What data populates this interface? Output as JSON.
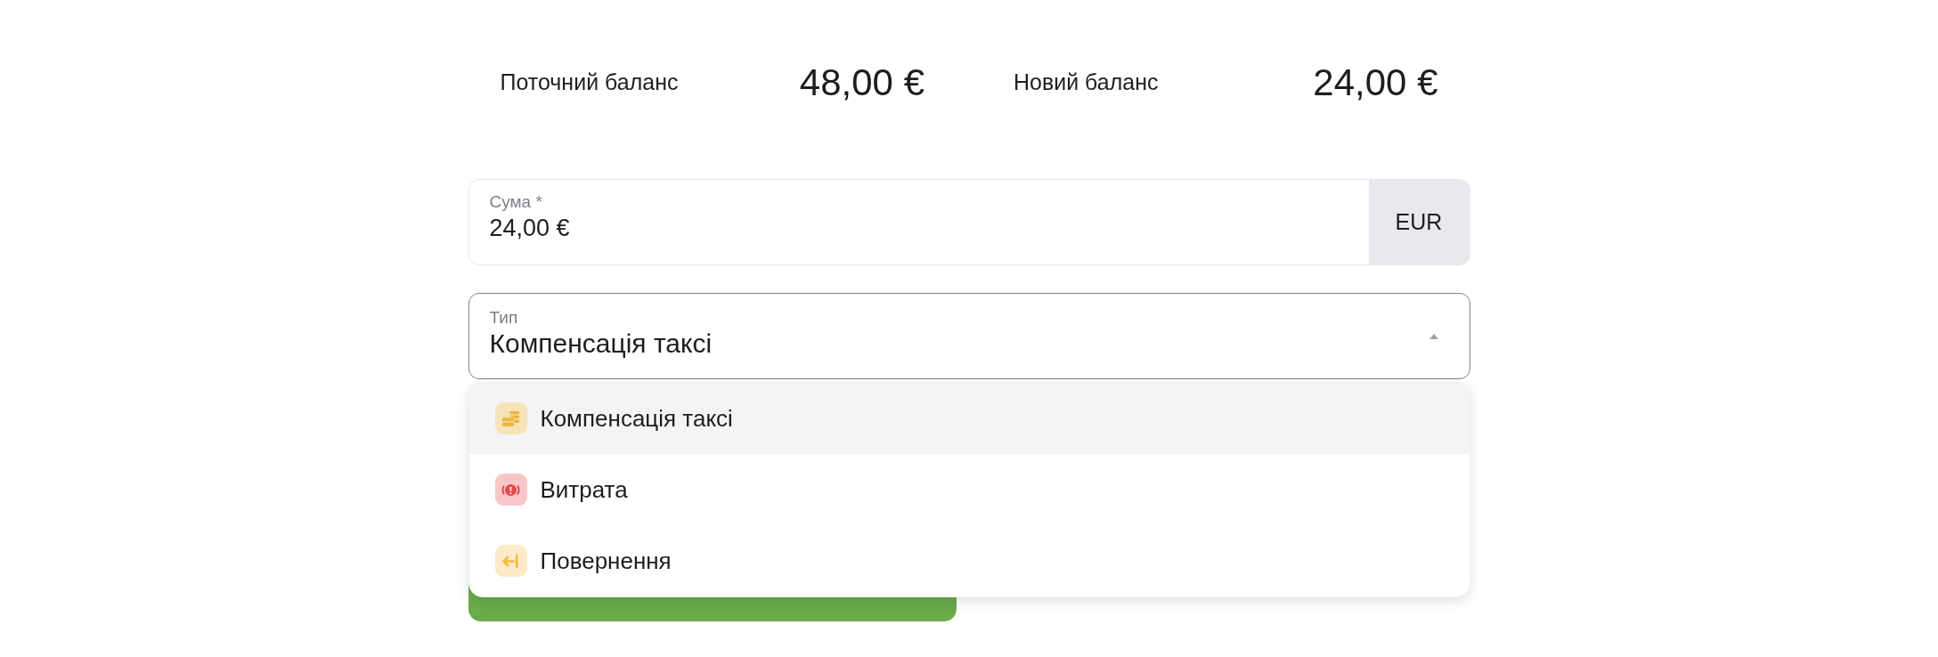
{
  "balances": [
    {
      "label": "Поточний баланс",
      "amount": "48,00 €"
    },
    {
      "label": "Новий баланс",
      "amount": "24,00 €"
    }
  ],
  "amount_field": {
    "label": "Сума *",
    "value": "24,00 €",
    "currency": "EUR"
  },
  "type_field": {
    "label": "Тип",
    "value": "Компенсація таксі",
    "expanded": true
  },
  "type_options": [
    {
      "label": "Компенсація таксі",
      "kind": "coins",
      "selected": true
    },
    {
      "label": "Витрата",
      "kind": "alert",
      "selected": false
    },
    {
      "label": "Повернення",
      "kind": "return",
      "selected": false
    }
  ]
}
